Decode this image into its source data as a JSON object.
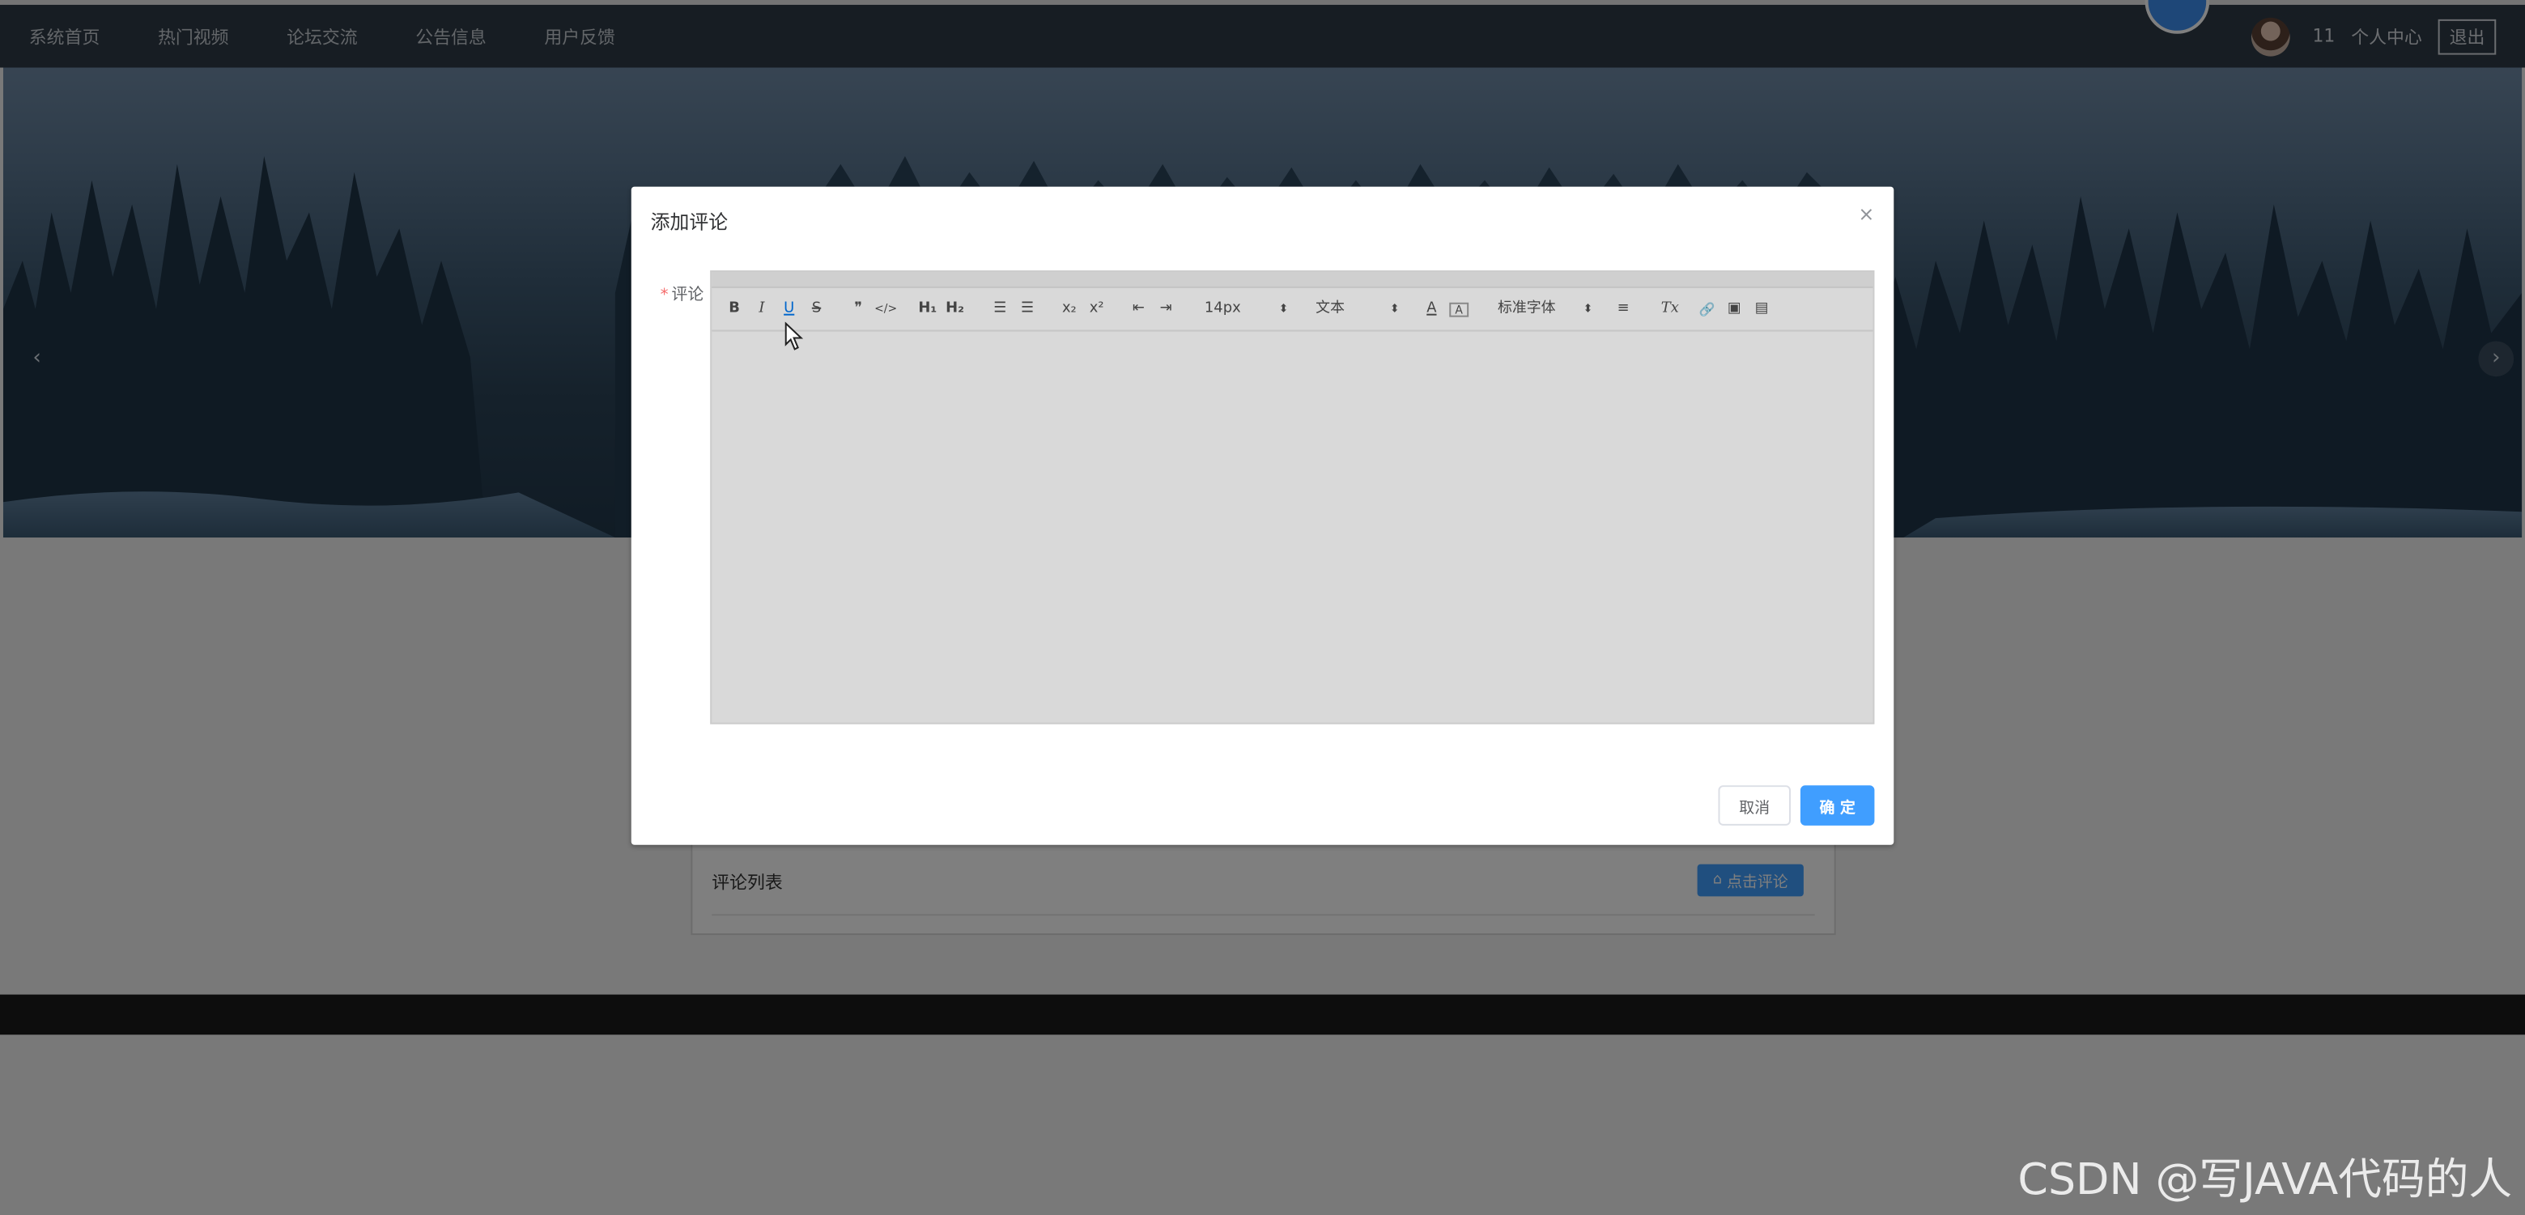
{
  "nav": {
    "items": [
      {
        "label": "系统首页"
      },
      {
        "label": "热门视频"
      },
      {
        "label": "论坛交流"
      },
      {
        "label": "公告信息"
      },
      {
        "label": "用户反馈"
      }
    ],
    "user": "11",
    "personal_center": "个人中心",
    "logout": "退出"
  },
  "carousel": {
    "prev_icon": "‹",
    "next_icon": "›"
  },
  "comments": {
    "title": "评论列表",
    "button_label": "点击评论",
    "button_icon": "home-icon"
  },
  "dialog": {
    "title": "添加评论",
    "close_icon": "×",
    "field_label": "评论",
    "required_mark": "*",
    "toolbar": {
      "bold": "B",
      "italic": "I",
      "underline": "U",
      "strike": "S",
      "blockquote": "❞",
      "code": "</>",
      "h1": "H₁",
      "h2": "H₂",
      "ordered_list": "☰",
      "bullet_list": "☰",
      "subscript": "x₂",
      "superscript": "x²",
      "outdent": "⇤",
      "indent": "⇥",
      "size_value": "14px",
      "header_value": "文本",
      "font_value": "标准字体",
      "color": "A",
      "background": "A",
      "align": "≡",
      "clean": "Tx",
      "link": "🔗",
      "image": "▣",
      "video": "▤"
    },
    "cancel": "取消",
    "confirm": "确 定"
  },
  "watermark": "CSDN @写JAVA代码的人",
  "colors": {
    "accent": "#409eff",
    "nav_bg": "#2e3a47",
    "required": "#f56c6c"
  }
}
